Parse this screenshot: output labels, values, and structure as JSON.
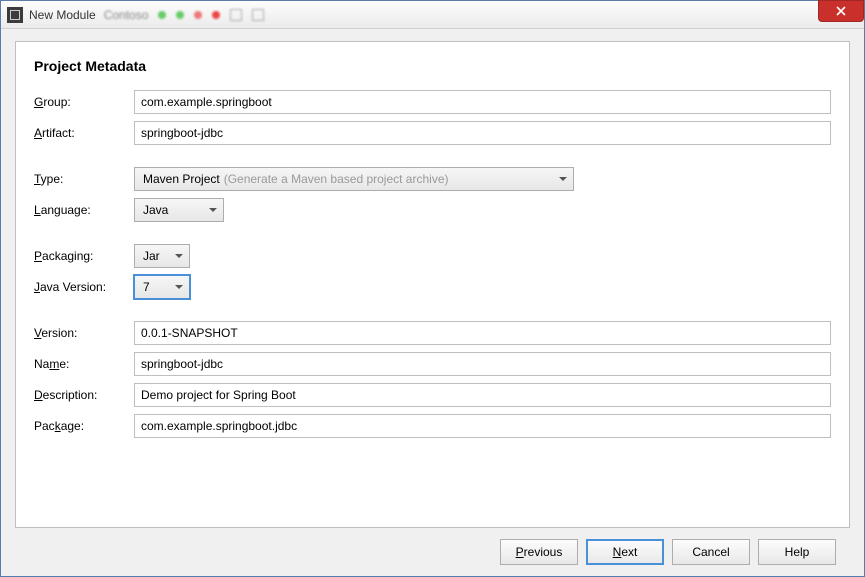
{
  "window": {
    "title": "New Module"
  },
  "heading": "Project Metadata",
  "labels": {
    "group": "roup:",
    "artifact": "rtifact:",
    "type": "ype:",
    "language": "anguage:",
    "packaging": "ackaging:",
    "javaVersion": "ava Version:",
    "version": "ersion:",
    "name": "Na",
    "name2": "e:",
    "description": "escription:",
    "package": "Pac",
    "package2": "age:"
  },
  "fields": {
    "group": "com.example.springboot",
    "artifact": "springboot-jdbc",
    "type": {
      "value": "Maven Project",
      "hint": "(Generate a Maven based project archive)"
    },
    "language": "Java",
    "packaging": "Jar",
    "javaVersion": "7",
    "version": "0.0.1-SNAPSHOT",
    "name": "springboot-jdbc",
    "description": "Demo project for Spring Boot",
    "package": "com.example.springboot.jdbc"
  },
  "buttons": {
    "previous": "revious",
    "next": "ext",
    "cancel": "Cancel",
    "help": "Help"
  }
}
